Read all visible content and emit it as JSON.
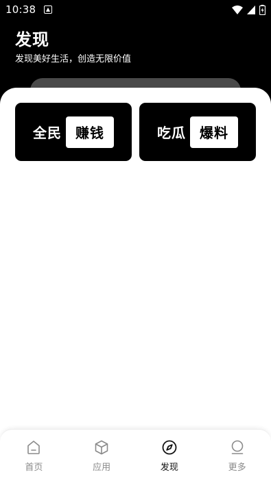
{
  "status_bar": {
    "time": "10:38"
  },
  "header": {
    "title": "发现",
    "subtitle": "发现美好生活，创造无限价值"
  },
  "banners": [
    {
      "word": "全民",
      "boxed": "赚钱"
    },
    {
      "word": "吃瓜",
      "boxed": "爆料"
    }
  ],
  "nav": {
    "items": [
      {
        "label": "首页",
        "icon": "home-icon"
      },
      {
        "label": "应用",
        "icon": "cube-icon"
      },
      {
        "label": "发现",
        "icon": "compass-icon"
      },
      {
        "label": "更多",
        "icon": "more-icon"
      }
    ],
    "active": "发现"
  },
  "colors": {
    "header_bg": "#000000",
    "sheet_bg": "#ffffff",
    "nav_inactive": "#8a8a8a",
    "nav_active": "#111111"
  }
}
